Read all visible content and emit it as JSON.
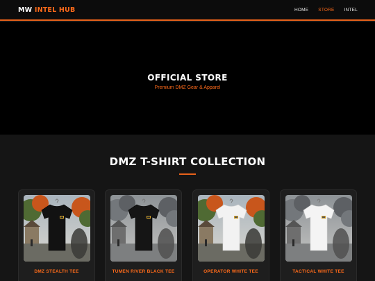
{
  "brand": {
    "part1": "MW",
    "part2": "INTEL HUB"
  },
  "nav": [
    {
      "label": "HOME",
      "active": false
    },
    {
      "label": "STORE",
      "active": true
    },
    {
      "label": "INTEL",
      "active": false
    }
  ],
  "hero": {
    "title": "OFFICIAL STORE",
    "subtitle": "Premium DMZ Gear & Apparel"
  },
  "collection": {
    "title": "DMZ T-SHIRT COLLECTION",
    "products": [
      {
        "name": "DMZ STEALTH TEE",
        "shirt_color": "#121212",
        "scene": "autumn"
      },
      {
        "name": "TUMEN RIVER BLACK TEE",
        "shirt_color": "#151515",
        "scene": "grey"
      },
      {
        "name": "OPERATOR WHITE TEE",
        "shirt_color": "#f2f2f2",
        "scene": "autumn"
      },
      {
        "name": "TACTICAL WHITE TEE",
        "shirt_color": "#f4f4f4",
        "scene": "grey"
      }
    ]
  },
  "colors": {
    "accent": "#ff6b1a",
    "nav_bg": "#0c0c0c",
    "hero_bg": "#000000",
    "section_bg": "#151515",
    "card_bg": "#1e1e1e"
  }
}
